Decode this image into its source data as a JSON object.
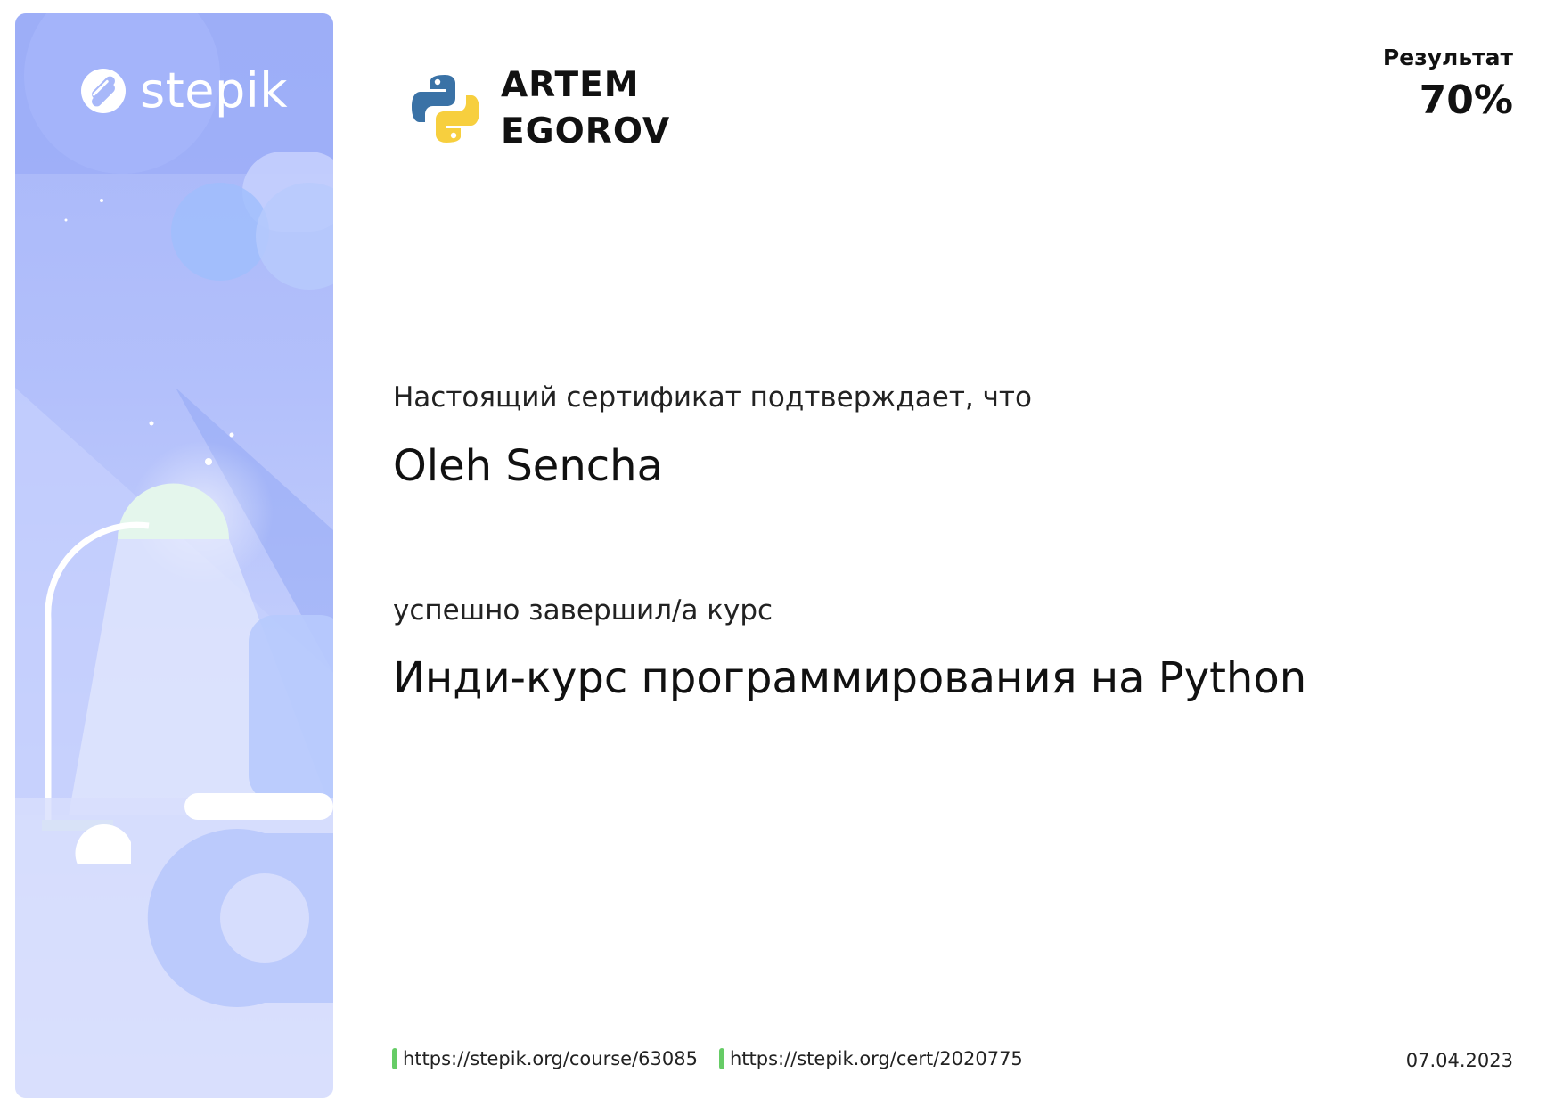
{
  "platform": {
    "name": "stepik",
    "logo_icon": "stepik-logo-icon"
  },
  "issuer": {
    "icon": "python-logo-icon",
    "line1": "ARTEM",
    "line2": "EGOROV"
  },
  "result": {
    "label": "Результат",
    "value": "70%"
  },
  "certificate": {
    "intro": "Настоящий сертификат подтверждает, что",
    "student": "Oleh Sencha",
    "completed": "успешно завершил/а  курс",
    "course": "Инди-курс программирования на Python"
  },
  "footer": {
    "course_url": "https://stepik.org/course/63085",
    "cert_url": "https://stepik.org/cert/2020775",
    "date": "07.04.2023",
    "accent": "#66cc66"
  },
  "colors": {
    "panel": "#b3c0fb",
    "python_blue": "#3a72a6",
    "python_yellow": "#f7cf3e"
  }
}
